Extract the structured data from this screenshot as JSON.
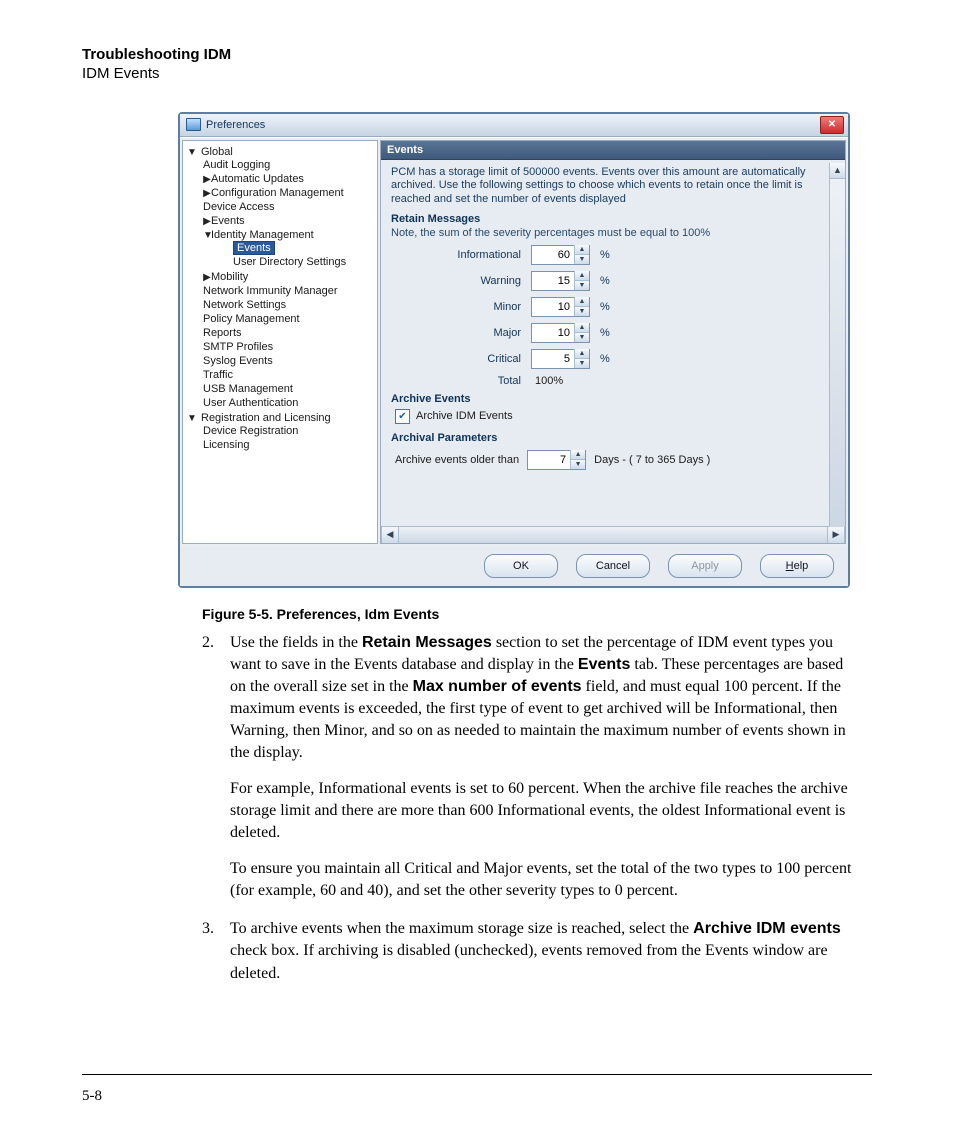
{
  "header": {
    "title": "Troubleshooting IDM",
    "subtitle": "IDM Events"
  },
  "dialog": {
    "title": "Preferences",
    "tree": {
      "root": "Global",
      "items": {
        "audit": "Audit Logging",
        "auto": "Automatic Updates",
        "cfg": "Configuration Management",
        "dev": "Device Access",
        "events": "Events",
        "idm": "Identity Management",
        "idm_events": "Events",
        "uds": "User Directory Settings",
        "mob": "Mobility",
        "nim": "Network Immunity Manager",
        "ns": "Network Settings",
        "pm": "Policy Management",
        "rep": "Reports",
        "smtp": "SMTP Profiles",
        "sys": "Syslog Events",
        "traf": "Traffic",
        "usb": "USB Management",
        "ua": "User Authentication",
        "reg": "Registration and Licensing",
        "dreg": "Device Registration",
        "lic": "Licensing"
      }
    },
    "panel": {
      "heading": "Events",
      "intro": "PCM has a storage limit of 500000 events. Events over this amount are automatically archived. Use the following settings to choose which events to retain once the limit is reached and set the number of events displayed",
      "retain_heading": "Retain Messages",
      "retain_note": "Note, the sum of the severity percentages must be equal to 100%",
      "rows": {
        "info_l": "Informational",
        "info_v": "60",
        "warn_l": "Warning",
        "warn_v": "15",
        "minor_l": "Minor",
        "minor_v": "10",
        "major_l": "Major",
        "major_v": "10",
        "crit_l": "Critical",
        "crit_v": "5",
        "total_l": "Total",
        "total_v": "100%"
      },
      "pct": "%",
      "archive_heading": "Archive Events",
      "archive_chk": "Archive IDM Events",
      "archparam_heading": "Archival Parameters",
      "arch_label": "Archive events older than",
      "arch_days": "7",
      "arch_suffix": "Days  -  ( 7 to 365 Days )"
    },
    "buttons": {
      "ok": "OK",
      "cancel": "Cancel",
      "apply": "Apply",
      "help": "elp",
      "help_u": "H"
    }
  },
  "caption": "Figure 5-5. Preferences, Idm Events",
  "text": {
    "p2a": "Use the fields in the ",
    "p2b": "Retain Messages",
    "p2c": " section to set the percentage of IDM event types you want to save in the Events database and display in the ",
    "p2d": "Events",
    "p2e": " tab. These percentages are based on the overall size set in the ",
    "p2f": "Max number of events",
    "p2g": " field, and must equal 100 percent. If the maximum events is exceeded, the first type of event to get archived will be Informational, then Warning, then Minor, and so on as needed to maintain the maximum number of events shown in the display.",
    "p3": "For example, Informational events is set to 60 percent. When the archive file reaches the archive storage limit and there are more than 600 Informational events, the oldest Informational event is deleted.",
    "p4": "To ensure you maintain all Critical and Major events, set the total of the two types to 100 percent (for example, 60 and 40), and set the other severity types to 0 percent.",
    "p5a": "To archive events when the maximum storage size is reached, select the ",
    "p5b": "Archive IDM events",
    "p5c": " check box. If archiving is disabled (unchecked), events removed from the Events window are deleted."
  },
  "pagenum": "5-8"
}
